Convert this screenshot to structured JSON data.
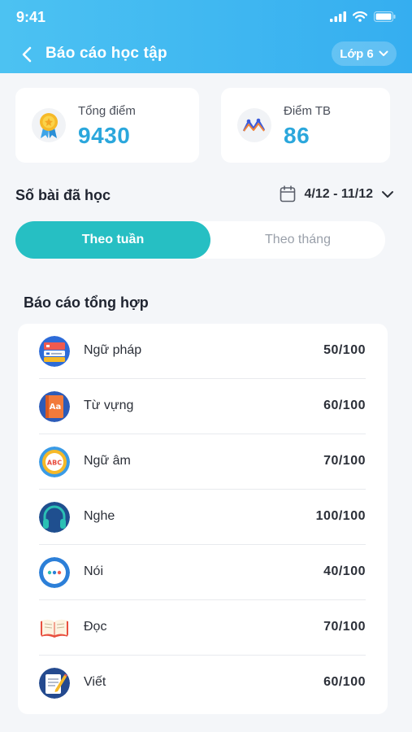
{
  "status_bar": {
    "time": "9:41"
  },
  "header": {
    "title": "Báo cáo học tập",
    "grade": "Lớp 6"
  },
  "score_cards": [
    {
      "label": "Tổng điểm",
      "value": "9430",
      "icon": "medal-icon"
    },
    {
      "label": "Điểm TB",
      "value": "86",
      "icon": "chart-line-icon"
    }
  ],
  "lessons": {
    "title": "Số bài đã học",
    "date_range": "4/12 - 11/12"
  },
  "toggle": {
    "active": "Theo tuần",
    "inactive": "Theo tháng"
  },
  "summary": {
    "title": "Báo cáo tổng hợp",
    "items": [
      {
        "label": "Ngữ pháp",
        "score": "50/100",
        "icon": "grammar-icon"
      },
      {
        "label": "Từ vựng",
        "score": "60/100",
        "icon": "vocabulary-icon"
      },
      {
        "label": "Ngữ âm",
        "score": "70/100",
        "icon": "phonetics-icon"
      },
      {
        "label": "Nghe",
        "score": "100/100",
        "icon": "headphones-icon"
      },
      {
        "label": "Nói",
        "score": "40/100",
        "icon": "speech-bubble-icon"
      },
      {
        "label": "Đọc",
        "score": "70/100",
        "icon": "book-icon"
      },
      {
        "label": "Viết",
        "score": "60/100",
        "icon": "writing-icon"
      }
    ]
  }
}
